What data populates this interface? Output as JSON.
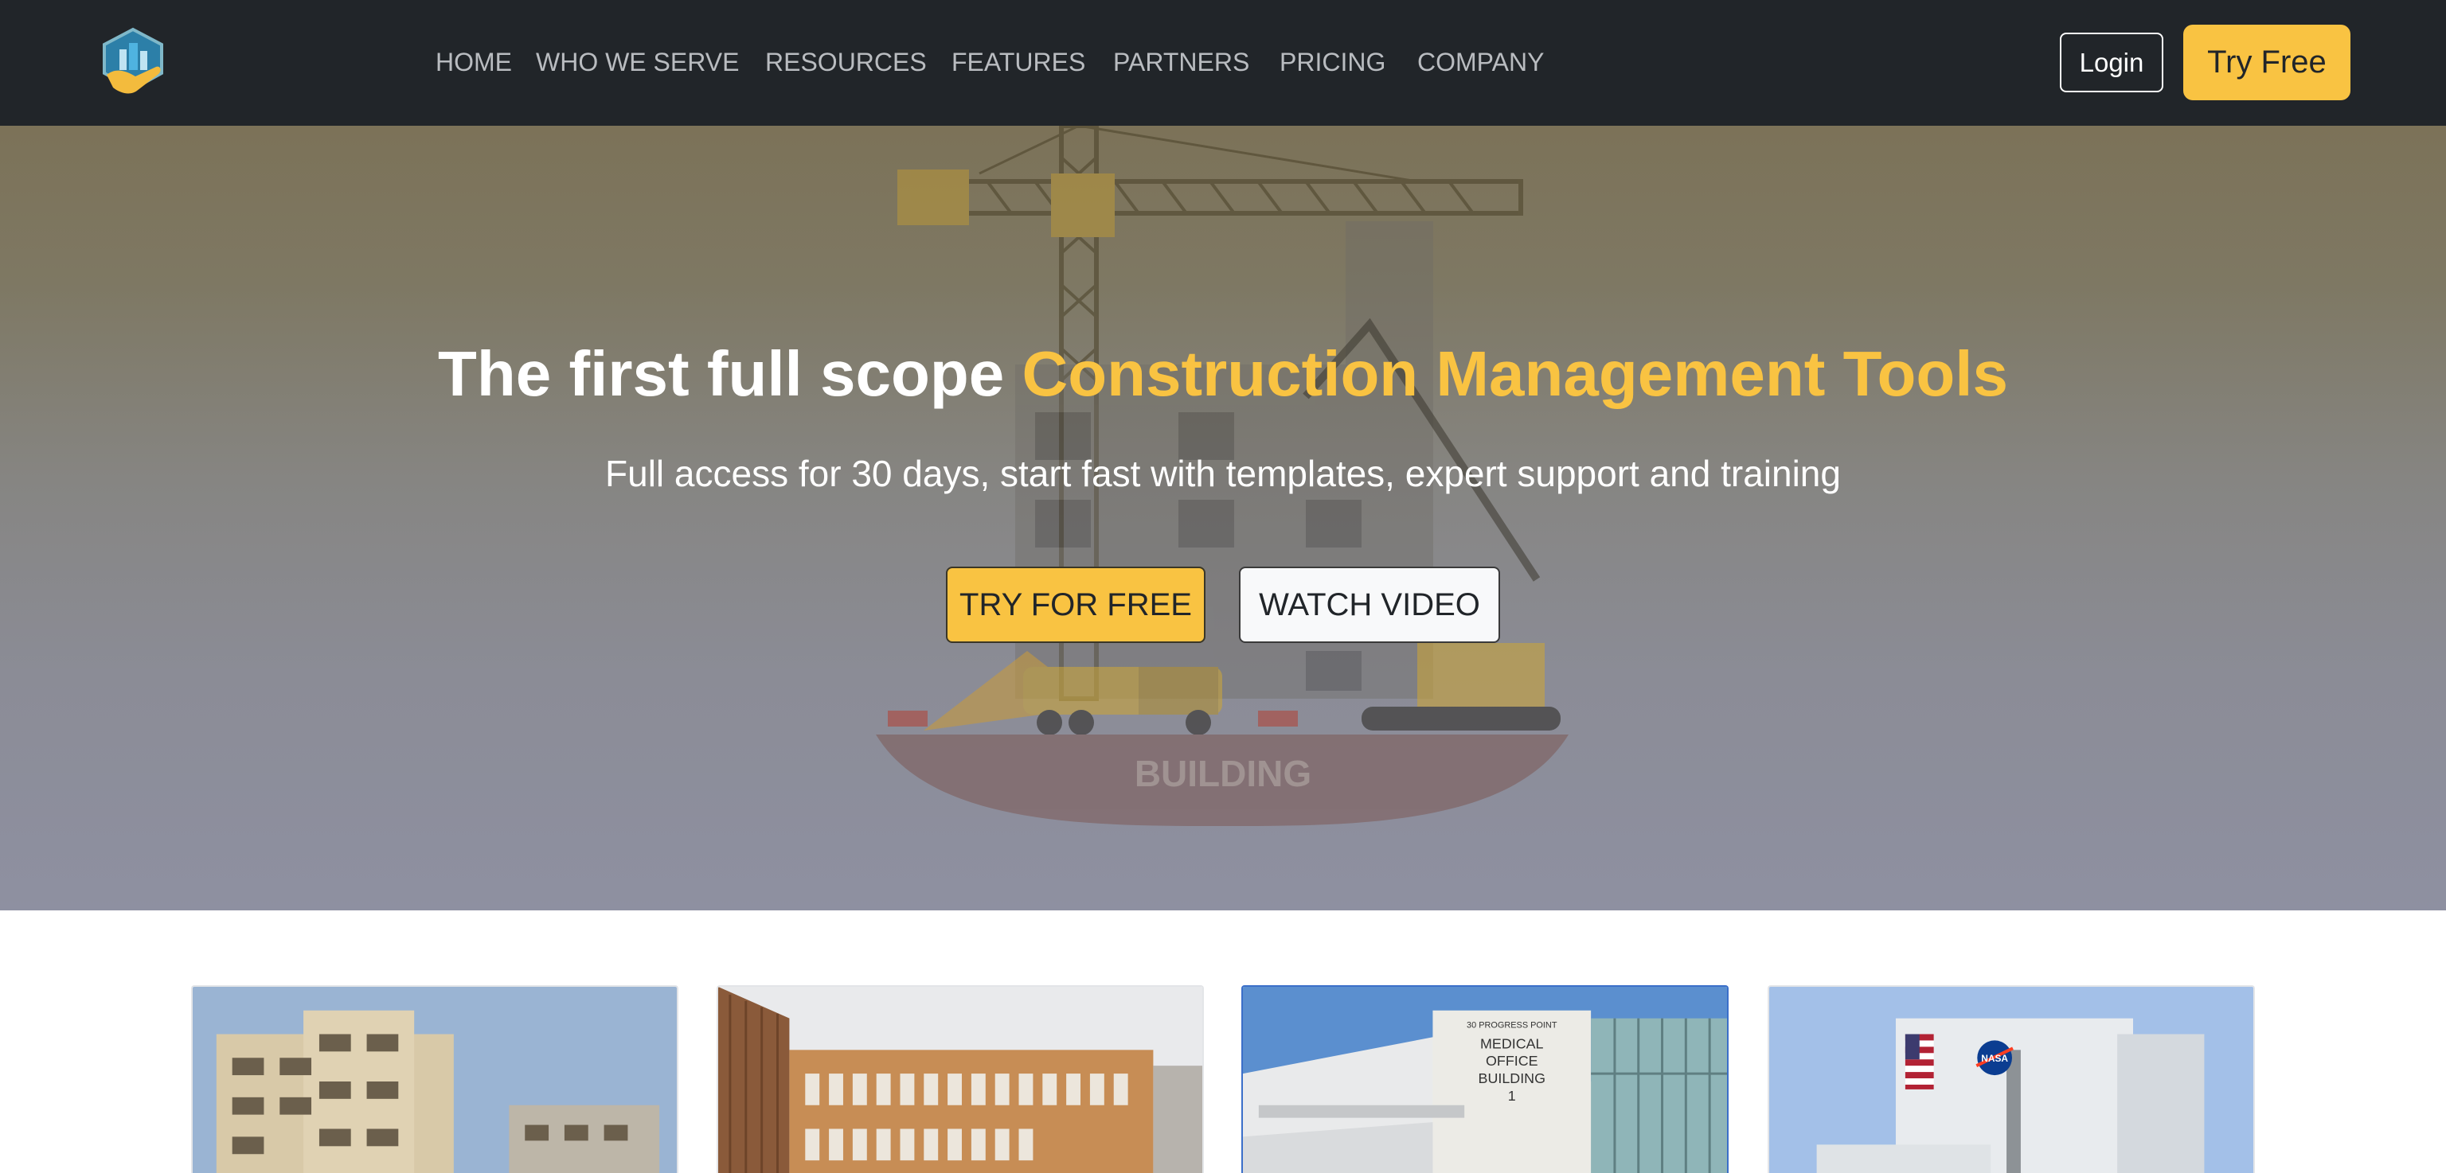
{
  "nav": {
    "logo_icon": "building-shield-logo",
    "links": [
      "HOME",
      "WHO WE SERVE",
      "RESOURCES",
      "FEATURES",
      "PARTNERS",
      "PRICING",
      "COMPANY"
    ],
    "login_label": "Login",
    "try_free_label": "Try Free"
  },
  "hero": {
    "title_plain": "The first full scope ",
    "title_accent": "Construction Management Tools",
    "subtitle": "Full access for 30 days, start fast with templates, expert support and training",
    "primary_button": "TRY FOR FREE",
    "secondary_button": "WATCH VIDEO",
    "illustration_label": "BUILDING"
  },
  "cards": [
    {
      "subject": "apartment-building-under-construction"
    },
    {
      "subject": "modern-wooden-facade-building"
    },
    {
      "subject": "medical-office-building",
      "sign_line1": "30 PROGRESS POINT",
      "sign_line2": "MEDICAL",
      "sign_line3": "OFFICE",
      "sign_line4": "BUILDING",
      "sign_line5": "1"
    },
    {
      "subject": "nasa-vehicle-assembly-building",
      "logo_text": "NASA"
    }
  ],
  "colors": {
    "navbar": "#212529",
    "accent": "#f9c342",
    "nav_link": "#b9bcc0",
    "card_selected_border": "#3b6fc9"
  }
}
